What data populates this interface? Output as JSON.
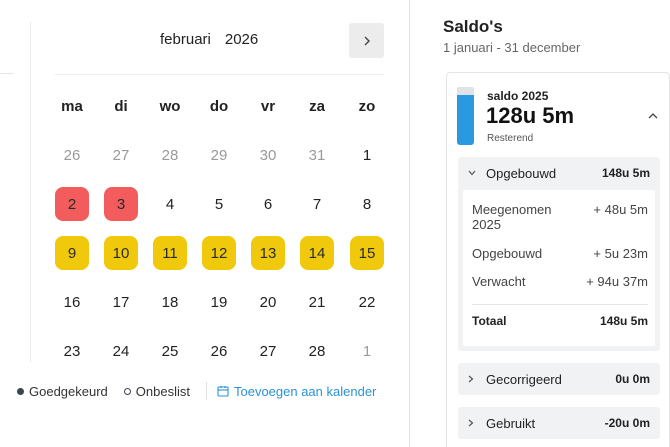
{
  "calendar": {
    "month": "februari",
    "year": "2026",
    "weekdays": [
      "ma",
      "di",
      "wo",
      "do",
      "vr",
      "za",
      "zo"
    ],
    "weeks": [
      [
        {
          "d": "26",
          "s": "muted"
        },
        {
          "d": "27",
          "s": "muted"
        },
        {
          "d": "28",
          "s": "muted"
        },
        {
          "d": "29",
          "s": "muted"
        },
        {
          "d": "30",
          "s": "muted"
        },
        {
          "d": "31",
          "s": "muted"
        },
        {
          "d": "1",
          "s": ""
        }
      ],
      [
        {
          "d": "2",
          "s": "red"
        },
        {
          "d": "3",
          "s": "red"
        },
        {
          "d": "4",
          "s": ""
        },
        {
          "d": "5",
          "s": ""
        },
        {
          "d": "6",
          "s": ""
        },
        {
          "d": "7",
          "s": ""
        },
        {
          "d": "8",
          "s": ""
        }
      ],
      [
        {
          "d": "9",
          "s": "yellow"
        },
        {
          "d": "10",
          "s": "yellow"
        },
        {
          "d": "11",
          "s": "yellow"
        },
        {
          "d": "12",
          "s": "yellow"
        },
        {
          "d": "13",
          "s": "yellow"
        },
        {
          "d": "14",
          "s": "yellow"
        },
        {
          "d": "15",
          "s": "yellow"
        }
      ],
      [
        {
          "d": "16",
          "s": ""
        },
        {
          "d": "17",
          "s": ""
        },
        {
          "d": "18",
          "s": ""
        },
        {
          "d": "19",
          "s": ""
        },
        {
          "d": "20",
          "s": ""
        },
        {
          "d": "21",
          "s": ""
        },
        {
          "d": "22",
          "s": ""
        }
      ],
      [
        {
          "d": "23",
          "s": ""
        },
        {
          "d": "24",
          "s": ""
        },
        {
          "d": "25",
          "s": ""
        },
        {
          "d": "26",
          "s": ""
        },
        {
          "d": "27",
          "s": ""
        },
        {
          "d": "28",
          "s": ""
        },
        {
          "d": "1",
          "s": "muted"
        }
      ]
    ],
    "next_icon": "chevron-right-icon"
  },
  "legend": {
    "approved": "Goedgekeurd",
    "undecided": "Onbeslist",
    "add_calendar": "Toevoegen aan kalender"
  },
  "saldos": {
    "title": "Saldo's",
    "range": "1 januari - 31 december",
    "balance": {
      "label": "saldo 2025",
      "value": "128u 5m",
      "sub": "Resterend",
      "remaining_fraction": 0.87,
      "bar_color": "#2a9ae0"
    },
    "opgebouwd": {
      "label": "Opgebouwd",
      "value": "148u 5m",
      "rows": [
        {
          "label": "Meegenomen 2025",
          "value": "+ 48u 5m"
        },
        {
          "label": "Opgebouwd",
          "value": "+ 5u 23m"
        },
        {
          "label": "Verwacht",
          "value": "+ 94u 37m"
        }
      ],
      "total_label": "Totaal",
      "total_value": "148u 5m"
    },
    "gecorrigeerd": {
      "label": "Gecorrigeerd",
      "value": "0u 0m"
    },
    "gebruikt": {
      "label": "Gebruikt",
      "value": "-20u 0m"
    }
  },
  "colors": {
    "red": "#f25c5c",
    "yellow": "#f0c90c",
    "accent": "#2a93d5"
  }
}
